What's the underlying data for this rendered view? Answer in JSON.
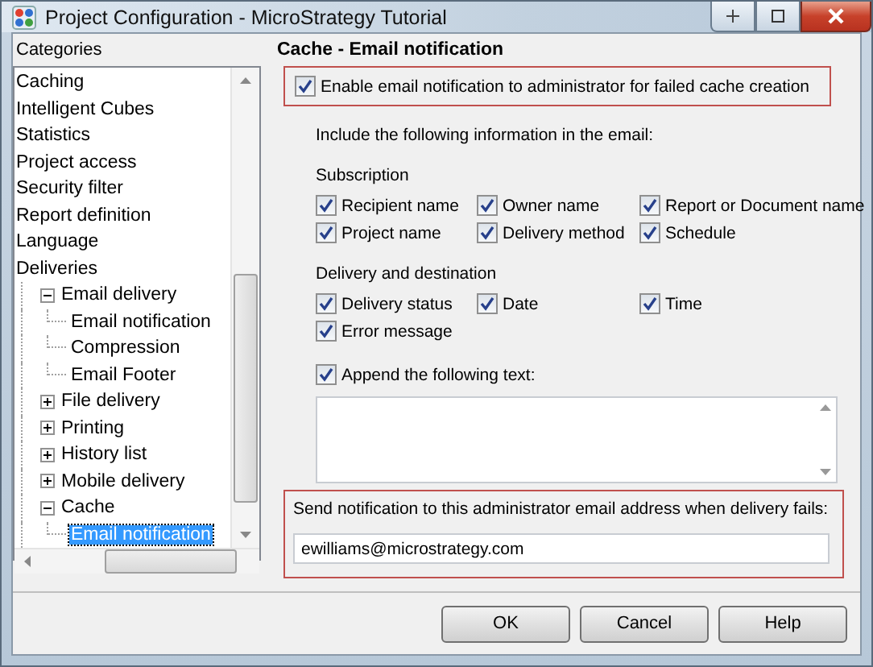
{
  "window": {
    "title": "Project Configuration - MicroStrategy Tutorial"
  },
  "categories": {
    "label": "Categories",
    "items": [
      {
        "label": "Caching",
        "selected": false
      },
      {
        "label": "Intelligent Cubes",
        "selected": false
      },
      {
        "label": "Statistics",
        "selected": false
      },
      {
        "label": "Project access",
        "selected": false
      },
      {
        "label": "Security filter",
        "selected": false
      },
      {
        "label": "Report definition",
        "selected": false
      },
      {
        "label": "Language",
        "selected": false
      },
      {
        "label": "Deliveries",
        "selected": false,
        "children": [
          {
            "label": "Email delivery",
            "selected": false,
            "expanded": true,
            "children": [
              {
                "label": "Email notification",
                "selected": false
              },
              {
                "label": "Compression",
                "selected": false
              },
              {
                "label": "Email Footer",
                "selected": false
              }
            ]
          },
          {
            "label": "File delivery",
            "selected": false,
            "expanded": false
          },
          {
            "label": "Printing",
            "selected": false,
            "expanded": false
          },
          {
            "label": "History list",
            "selected": false,
            "expanded": false
          },
          {
            "label": "Mobile delivery",
            "selected": false,
            "expanded": false
          },
          {
            "label": "Cache",
            "selected": false,
            "expanded": true,
            "children": [
              {
                "label": "Email notification",
                "selected": true
              }
            ]
          }
        ]
      }
    ]
  },
  "panel": {
    "title": "Cache - Email notification",
    "enable": {
      "label": "Enable email notification to administrator for failed cache creation",
      "checked": true
    },
    "include_label": "Include the following information in the email:",
    "groups": [
      {
        "title": "Subscription",
        "options": [
          {
            "label": "Recipient name",
            "checked": true
          },
          {
            "label": "Owner name",
            "checked": true
          },
          {
            "label": "Report or Document name",
            "checked": true
          },
          {
            "label": "Project name",
            "checked": true
          },
          {
            "label": "Delivery method",
            "checked": true
          },
          {
            "label": "Schedule",
            "checked": true
          }
        ]
      },
      {
        "title": "Delivery and destination",
        "options": [
          {
            "label": "Delivery status",
            "checked": true
          },
          {
            "label": "Date",
            "checked": true
          },
          {
            "label": "Time",
            "checked": true
          },
          {
            "label": "Error message",
            "checked": true
          }
        ]
      }
    ],
    "append": {
      "label": "Append the following text:",
      "checked": true
    },
    "admin_label": "Send notification to this administrator email address when delivery fails:",
    "admin_email": "ewilliams@microstrategy.com"
  },
  "buttons": [
    "OK",
    "Cancel",
    "Help"
  ]
}
